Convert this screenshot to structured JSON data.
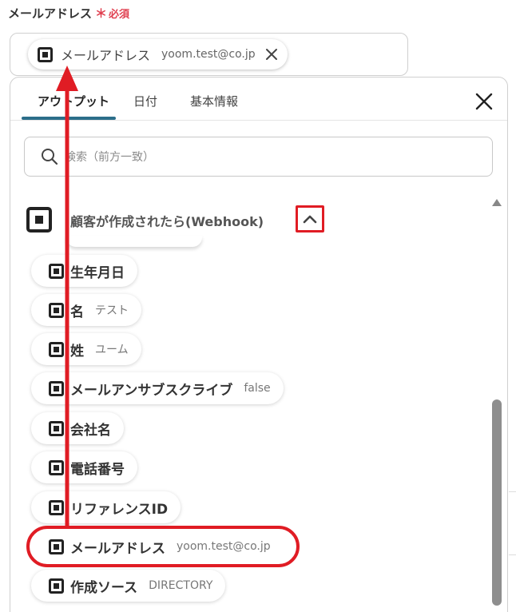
{
  "field": {
    "label": "メールアドレス",
    "required_mark": "＊",
    "required_text": "必須",
    "chip": {
      "label": "メールアドレス",
      "value": "yoom.test@co.jp"
    }
  },
  "panel": {
    "tabs": [
      {
        "label": "アウトプット",
        "active": true
      },
      {
        "label": "日付",
        "active": false
      },
      {
        "label": "基本情報",
        "active": false
      }
    ],
    "search_placeholder": "検索（前方一致）",
    "section_title": "顧客が作成されたら(Webhook)",
    "items": [
      {
        "label": "生年月日",
        "value": ""
      },
      {
        "label": "名",
        "value": "テスト"
      },
      {
        "label": "姓",
        "value": "ユーム"
      },
      {
        "label": "メールアンサブスクライブ",
        "value": "false"
      },
      {
        "label": "会社名",
        "value": ""
      },
      {
        "label": "電話番号",
        "value": ""
      },
      {
        "label": "リファレンスID",
        "value": ""
      },
      {
        "label": "メールアドレス",
        "value": "yoom.test@co.jp"
      },
      {
        "label": "作成ソース",
        "value": "DIRECTORY"
      }
    ]
  },
  "colors": {
    "accent": "#2c6e8a",
    "highlight": "#e01c24",
    "required": "#e04050"
  },
  "icons": [
    "square-service-icon",
    "close-icon",
    "search-icon",
    "chevron-up-icon"
  ]
}
